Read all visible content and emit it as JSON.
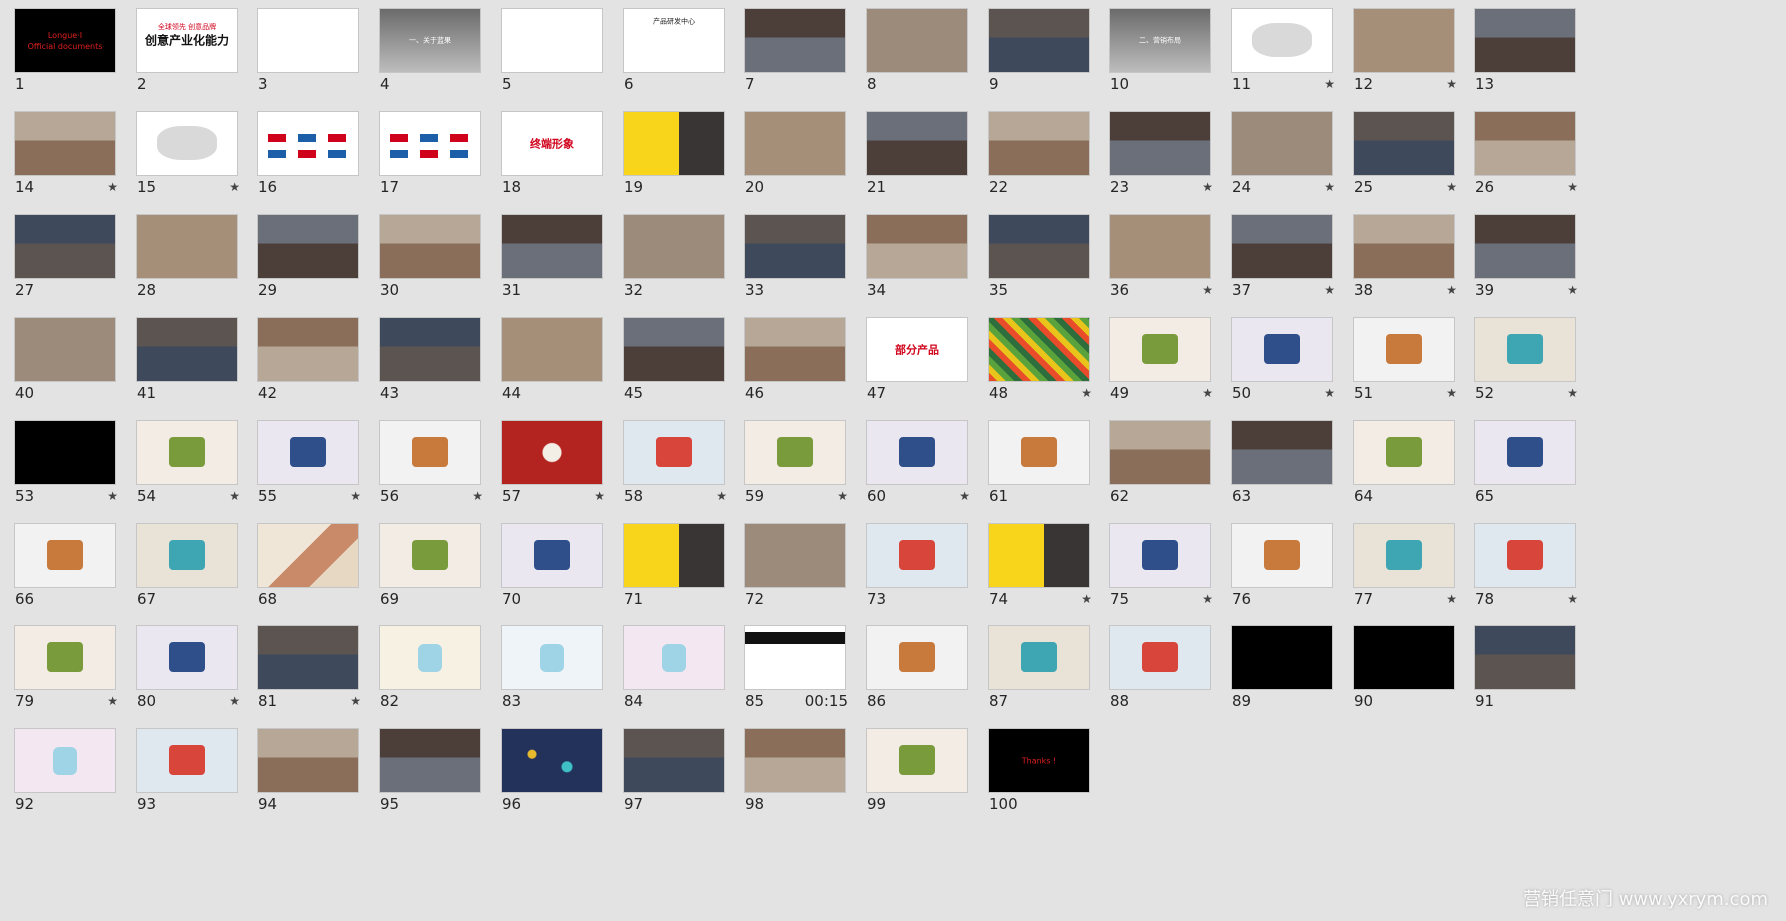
{
  "watermark": "营销任意门 www.yxrym.com",
  "slides": [
    {
      "n": "1",
      "star": false,
      "timing": "",
      "kind": "dark",
      "title": "Longue·I\nOfficial documents"
    },
    {
      "n": "2",
      "star": false,
      "timing": "",
      "kind": "white",
      "title": "创意产业化能力",
      "sub": "全球领先 创意品牌"
    },
    {
      "n": "3",
      "star": false,
      "timing": "",
      "kind": "white",
      "title": "",
      "sub": ""
    },
    {
      "n": "4",
      "star": false,
      "timing": "",
      "kind": "gray",
      "title": "一、关于蓝果"
    },
    {
      "n": "5",
      "star": false,
      "timing": "",
      "kind": "text",
      "title": ""
    },
    {
      "n": "6",
      "star": false,
      "timing": "",
      "kind": "text",
      "title": "产品研发中心"
    },
    {
      "n": "7",
      "star": false,
      "timing": "",
      "kind": "photo",
      "title": ""
    },
    {
      "n": "8",
      "star": false,
      "timing": "",
      "kind": "photo",
      "title": ""
    },
    {
      "n": "9",
      "star": false,
      "timing": "",
      "kind": "photo",
      "title": ""
    },
    {
      "n": "10",
      "star": false,
      "timing": "",
      "kind": "gray",
      "title": "二、营销布局"
    },
    {
      "n": "11",
      "star": true,
      "timing": "",
      "kind": "map",
      "title": ""
    },
    {
      "n": "12",
      "star": true,
      "timing": "",
      "kind": "photo",
      "title": ""
    },
    {
      "n": "13",
      "star": false,
      "timing": "",
      "kind": "photo",
      "title": ""
    },
    {
      "n": "14",
      "star": true,
      "timing": "",
      "kind": "photo",
      "title": ""
    },
    {
      "n": "15",
      "star": true,
      "timing": "",
      "kind": "map",
      "title": ""
    },
    {
      "n": "16",
      "star": false,
      "timing": "",
      "kind": "logos",
      "title": ""
    },
    {
      "n": "17",
      "star": false,
      "timing": "",
      "kind": "logos",
      "title": ""
    },
    {
      "n": "18",
      "star": false,
      "timing": "",
      "kind": "white",
      "title": "终端形象"
    },
    {
      "n": "19",
      "star": false,
      "timing": "",
      "kind": "yellow",
      "title": ""
    },
    {
      "n": "20",
      "star": false,
      "timing": "",
      "kind": "photo",
      "title": ""
    },
    {
      "n": "21",
      "star": false,
      "timing": "",
      "kind": "photo",
      "title": ""
    },
    {
      "n": "22",
      "star": false,
      "timing": "",
      "kind": "photo",
      "title": ""
    },
    {
      "n": "23",
      "star": true,
      "timing": "",
      "kind": "photo",
      "title": ""
    },
    {
      "n": "24",
      "star": true,
      "timing": "",
      "kind": "photo",
      "title": ""
    },
    {
      "n": "25",
      "star": true,
      "timing": "",
      "kind": "photo",
      "title": ""
    },
    {
      "n": "26",
      "star": true,
      "timing": "",
      "kind": "photo",
      "title": ""
    },
    {
      "n": "27",
      "star": false,
      "timing": "",
      "kind": "photo",
      "title": ""
    },
    {
      "n": "28",
      "star": false,
      "timing": "",
      "kind": "photo",
      "title": ""
    },
    {
      "n": "29",
      "star": false,
      "timing": "",
      "kind": "photo",
      "title": ""
    },
    {
      "n": "30",
      "star": false,
      "timing": "",
      "kind": "photo",
      "title": ""
    },
    {
      "n": "31",
      "star": false,
      "timing": "",
      "kind": "photo",
      "title": ""
    },
    {
      "n": "32",
      "star": false,
      "timing": "",
      "kind": "photo",
      "title": ""
    },
    {
      "n": "33",
      "star": false,
      "timing": "",
      "kind": "photo",
      "title": ""
    },
    {
      "n": "34",
      "star": false,
      "timing": "",
      "kind": "photo",
      "title": ""
    },
    {
      "n": "35",
      "star": false,
      "timing": "",
      "kind": "photo",
      "title": ""
    },
    {
      "n": "36",
      "star": true,
      "timing": "",
      "kind": "photo",
      "title": ""
    },
    {
      "n": "37",
      "star": true,
      "timing": "",
      "kind": "photo",
      "title": ""
    },
    {
      "n": "38",
      "star": true,
      "timing": "",
      "kind": "photo",
      "title": ""
    },
    {
      "n": "39",
      "star": true,
      "timing": "",
      "kind": "photo",
      "title": ""
    },
    {
      "n": "40",
      "star": false,
      "timing": "",
      "kind": "photo",
      "title": ""
    },
    {
      "n": "41",
      "star": false,
      "timing": "",
      "kind": "photo",
      "title": ""
    },
    {
      "n": "42",
      "star": false,
      "timing": "",
      "kind": "photo",
      "title": ""
    },
    {
      "n": "43",
      "star": false,
      "timing": "",
      "kind": "photo",
      "title": ""
    },
    {
      "n": "44",
      "star": false,
      "timing": "",
      "kind": "photo",
      "title": ""
    },
    {
      "n": "45",
      "star": false,
      "timing": "",
      "kind": "photo",
      "title": ""
    },
    {
      "n": "46",
      "star": false,
      "timing": "",
      "kind": "photo",
      "title": ""
    },
    {
      "n": "47",
      "star": false,
      "timing": "",
      "kind": "white",
      "title": "部分产品"
    },
    {
      "n": "48",
      "star": true,
      "timing": "",
      "kind": "pattern",
      "title": ""
    },
    {
      "n": "49",
      "star": true,
      "timing": "",
      "kind": "product",
      "title": ""
    },
    {
      "n": "50",
      "star": true,
      "timing": "",
      "kind": "product",
      "title": ""
    },
    {
      "n": "51",
      "star": true,
      "timing": "",
      "kind": "product",
      "title": ""
    },
    {
      "n": "52",
      "star": true,
      "timing": "",
      "kind": "product",
      "title": ""
    },
    {
      "n": "53",
      "star": true,
      "timing": "",
      "kind": "dark",
      "title": ""
    },
    {
      "n": "54",
      "star": true,
      "timing": "",
      "kind": "product",
      "title": ""
    },
    {
      "n": "55",
      "star": true,
      "timing": "",
      "kind": "product",
      "title": ""
    },
    {
      "n": "56",
      "star": true,
      "timing": "",
      "kind": "product",
      "title": ""
    },
    {
      "n": "57",
      "star": true,
      "timing": "",
      "kind": "red",
      "title": ""
    },
    {
      "n": "58",
      "star": true,
      "timing": "",
      "kind": "product",
      "title": ""
    },
    {
      "n": "59",
      "star": true,
      "timing": "",
      "kind": "product",
      "title": ""
    },
    {
      "n": "60",
      "star": true,
      "timing": "",
      "kind": "product",
      "title": ""
    },
    {
      "n": "61",
      "star": false,
      "timing": "",
      "kind": "product",
      "title": ""
    },
    {
      "n": "62",
      "star": false,
      "timing": "",
      "kind": "photo",
      "title": ""
    },
    {
      "n": "63",
      "star": false,
      "timing": "",
      "kind": "photo",
      "title": ""
    },
    {
      "n": "64",
      "star": false,
      "timing": "",
      "kind": "product",
      "title": ""
    },
    {
      "n": "65",
      "star": false,
      "timing": "",
      "kind": "product",
      "title": ""
    },
    {
      "n": "66",
      "star": false,
      "timing": "",
      "kind": "product",
      "title": ""
    },
    {
      "n": "67",
      "star": false,
      "timing": "",
      "kind": "product",
      "title": ""
    },
    {
      "n": "68",
      "star": false,
      "timing": "",
      "kind": "art",
      "title": ""
    },
    {
      "n": "69",
      "star": false,
      "timing": "",
      "kind": "product",
      "title": ""
    },
    {
      "n": "70",
      "star": false,
      "timing": "",
      "kind": "product",
      "title": ""
    },
    {
      "n": "71",
      "star": false,
      "timing": "",
      "kind": "yellow",
      "title": ""
    },
    {
      "n": "72",
      "star": false,
      "timing": "",
      "kind": "photo",
      "title": ""
    },
    {
      "n": "73",
      "star": false,
      "timing": "",
      "kind": "product",
      "title": ""
    },
    {
      "n": "74",
      "star": true,
      "timing": "",
      "kind": "yellow",
      "title": ""
    },
    {
      "n": "75",
      "star": true,
      "timing": "",
      "kind": "product",
      "title": ""
    },
    {
      "n": "76",
      "star": false,
      "timing": "",
      "kind": "product",
      "title": ""
    },
    {
      "n": "77",
      "star": true,
      "timing": "",
      "kind": "product",
      "title": ""
    },
    {
      "n": "78",
      "star": true,
      "timing": "",
      "kind": "product",
      "title": ""
    },
    {
      "n": "79",
      "star": true,
      "timing": "",
      "kind": "product",
      "title": ""
    },
    {
      "n": "80",
      "star": true,
      "timing": "",
      "kind": "product",
      "title": ""
    },
    {
      "n": "81",
      "star": true,
      "timing": "",
      "kind": "photo",
      "title": ""
    },
    {
      "n": "82",
      "star": false,
      "timing": "",
      "kind": "pastel",
      "title": ""
    },
    {
      "n": "83",
      "star": false,
      "timing": "",
      "kind": "pastel",
      "title": ""
    },
    {
      "n": "84",
      "star": false,
      "timing": "",
      "kind": "pastel",
      "title": ""
    },
    {
      "n": "85",
      "star": false,
      "timing": "00:15",
      "kind": "bw",
      "title": ""
    },
    {
      "n": "86",
      "star": false,
      "timing": "",
      "kind": "product",
      "title": ""
    },
    {
      "n": "87",
      "star": false,
      "timing": "",
      "kind": "product",
      "title": ""
    },
    {
      "n": "88",
      "star": false,
      "timing": "",
      "kind": "product",
      "title": ""
    },
    {
      "n": "89",
      "star": false,
      "timing": "",
      "kind": "dark",
      "title": ""
    },
    {
      "n": "90",
      "star": false,
      "timing": "",
      "kind": "dark",
      "title": ""
    },
    {
      "n": "91",
      "star": false,
      "timing": "",
      "kind": "photo",
      "title": ""
    },
    {
      "n": "92",
      "star": false,
      "timing": "",
      "kind": "pastel",
      "title": ""
    },
    {
      "n": "93",
      "star": false,
      "timing": "",
      "kind": "product",
      "title": ""
    },
    {
      "n": "94",
      "star": false,
      "timing": "",
      "kind": "photo",
      "title": ""
    },
    {
      "n": "95",
      "star": false,
      "timing": "",
      "kind": "photo",
      "title": ""
    },
    {
      "n": "96",
      "star": false,
      "timing": "",
      "kind": "navy",
      "title": ""
    },
    {
      "n": "97",
      "star": false,
      "timing": "",
      "kind": "photo",
      "title": ""
    },
    {
      "n": "98",
      "star": false,
      "timing": "",
      "kind": "photo",
      "title": ""
    },
    {
      "n": "99",
      "star": false,
      "timing": "",
      "kind": "product",
      "title": ""
    },
    {
      "n": "100",
      "star": false,
      "timing": "",
      "kind": "dark",
      "title": "Thanks !"
    }
  ]
}
